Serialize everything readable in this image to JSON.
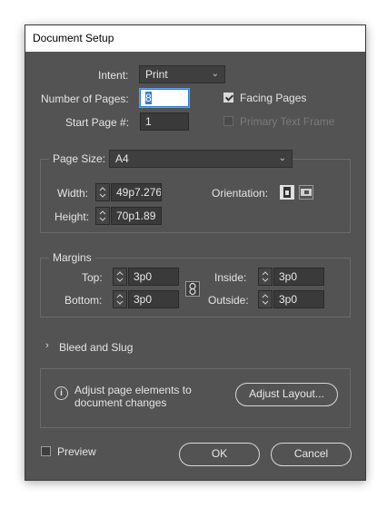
{
  "window": {
    "title": "Document Setup"
  },
  "intent": {
    "label": "Intent:",
    "value": "Print"
  },
  "pages": {
    "number_label": "Number of Pages:",
    "number_value": "8",
    "start_label": "Start Page #:",
    "start_value": "1",
    "facing_label": "Facing Pages",
    "facing_checked": true,
    "primary_label": "Primary Text Frame",
    "primary_checked": false
  },
  "page_size": {
    "label": "Page Size:",
    "value": "A4",
    "width_label": "Width:",
    "width_value": "49p7.276",
    "height_label": "Height:",
    "height_value": "70p1.89",
    "orientation_label": "Orientation:",
    "orientation_selected": "portrait"
  },
  "margins": {
    "title": "Margins",
    "top_label": "Top:",
    "top_value": "3p0",
    "bottom_label": "Bottom:",
    "bottom_value": "3p0",
    "inside_label": "Inside:",
    "inside_value": "3p0",
    "outside_label": "Outside:",
    "outside_value": "3p0",
    "linked": true
  },
  "bleed": {
    "label": "Bleed and Slug",
    "expanded": false
  },
  "info": {
    "line1": "Adjust page elements to",
    "line2": "document changes",
    "button_label": "Adjust Layout..."
  },
  "footer": {
    "preview_label": "Preview",
    "preview_checked": false,
    "ok_label": "OK",
    "cancel_label": "Cancel"
  },
  "colors": {
    "dialog_bg": "#535353",
    "focus_blue": "#3a7bd5"
  }
}
